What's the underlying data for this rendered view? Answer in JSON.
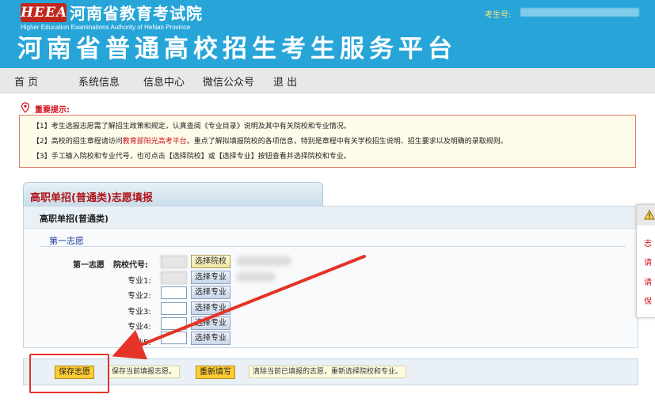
{
  "header": {
    "logo_text": "HEEA",
    "org_name": "河南省教育考试院",
    "org_en": "Higher Education Examinations Authority of HeNan Province",
    "platform_title": "河南省普通高校招生考生服务平台",
    "exam_no_label": "考生号:"
  },
  "nav": {
    "items": [
      "首  页",
      "系统信息",
      "信息中心",
      "微信公众号",
      "退  出"
    ]
  },
  "tips": {
    "title": "重要提示:",
    "line1": "【1】考生选报志愿需了解招生政策和规定，认真查阅《专业目录》说明及其中有关院校和专业情况。",
    "line2_pre": "【2】高校的招生章程请访问",
    "line2_link": "教育部阳光高考平台",
    "line2_post": "。重点了解拟填报院校的各项信息，特别是章程中有关学校招生说明、招生要求以及明确的录取规则。",
    "line3": "【3】手工输入院校和专业代号，也可点击【选择院校】或【选择专业】按钮查看并选择院校和专业。"
  },
  "form": {
    "tab_title": "高职单招(普通类)志愿填报",
    "panel_title": "高职单招(普通类)",
    "choice_title": "第一志愿",
    "row_label": "第一志愿",
    "school_code_label": "院校代号:",
    "select_school_btn": "选择院校",
    "select_major_btn": "选择专业",
    "majors": [
      "专业1:",
      "专业2:",
      "专业3:",
      "专业4:",
      "专业5:"
    ]
  },
  "actions": {
    "save_btn": "保存志愿",
    "save_hint": "保存当前填报志愿。",
    "reset_btn": "重新填写",
    "reset_hint": "清除当前已填报的志愿，重新选择院校和专业。"
  },
  "side_panel": {
    "icon": "warning-icon",
    "items": [
      "志",
      "请",
      "请",
      "保"
    ]
  },
  "colors": {
    "header_bg": "#27a5d9",
    "accent_red": "#d0111b",
    "annotation_red": "#e53327",
    "save_button": "#ffcc33"
  }
}
